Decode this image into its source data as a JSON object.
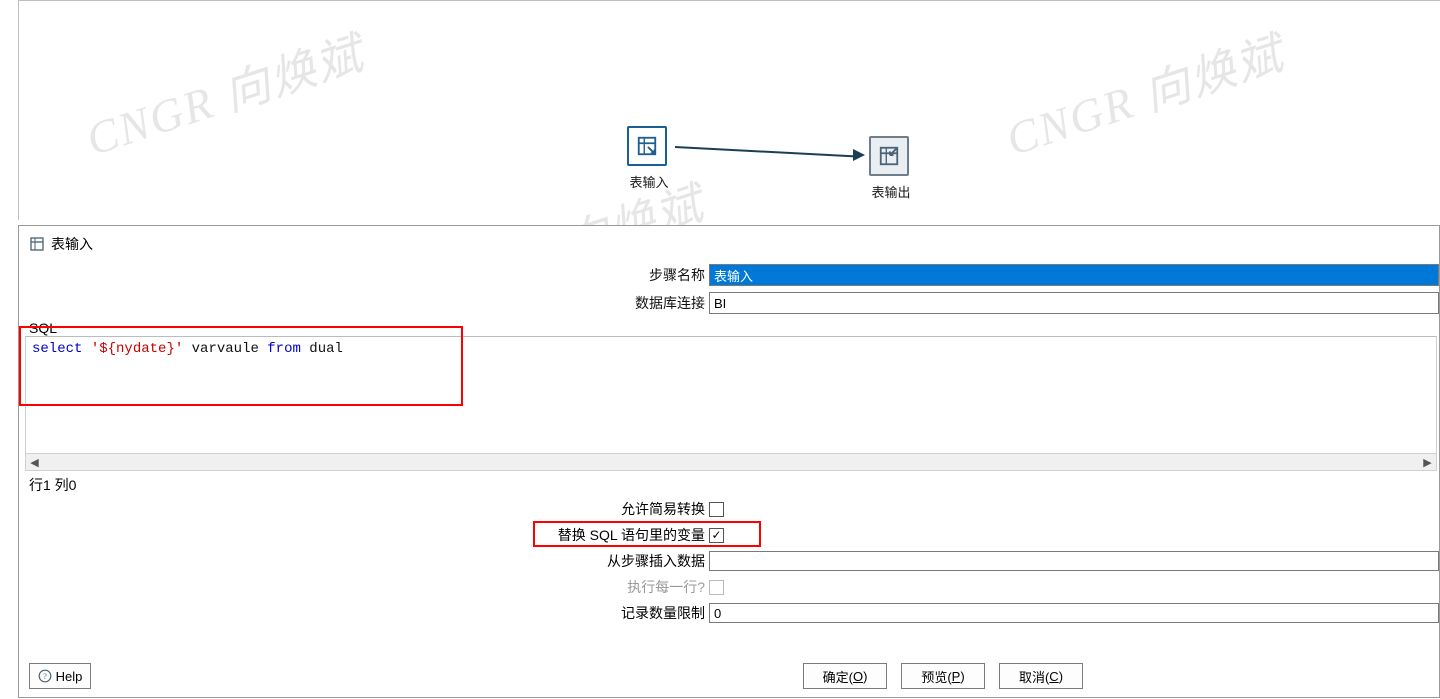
{
  "watermark": "CNGR 向焕斌",
  "canvas": {
    "node_in_label": "表输入",
    "node_out_label": "表输出"
  },
  "dialog": {
    "title": "表输入",
    "step_name_label": "步骤名称",
    "step_name_value": "表输入",
    "db_conn_label": "数据库连接",
    "db_conn_value": "BI",
    "sql_label": "SQL",
    "sql": {
      "kw1": "select",
      "str": "'${nydate}'",
      "id1": "varvaule",
      "kw2": "from",
      "id2": "dual"
    },
    "cursor_info": "行1 列0",
    "allow_lazy_label": "允许简易转换",
    "replace_vars_label": "替换 SQL 语句里的变量",
    "insert_from_step_label": "从步骤插入数据",
    "exec_each_row_label": "执行每一行?",
    "row_limit_label": "记录数量限制",
    "row_limit_value": "0",
    "help_label": "Help",
    "ok_label": "确定(",
    "ok_key": "O",
    "ok_tail": ")",
    "preview_label": "预览(",
    "preview_key": "P",
    "preview_tail": ")",
    "cancel_label": "取消(",
    "cancel_key": "C",
    "cancel_tail": ")"
  }
}
